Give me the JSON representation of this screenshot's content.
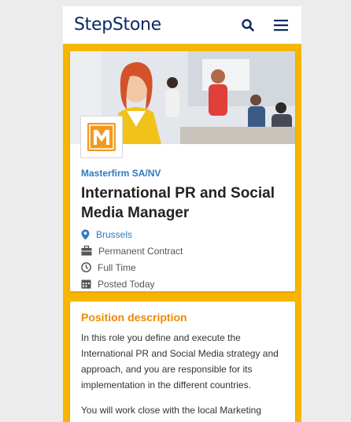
{
  "header": {
    "logo_text": "StepStone",
    "search_icon": "search-icon",
    "menu_icon": "hamburger-menu-icon"
  },
  "job": {
    "company": "Masterfirm SA/NV",
    "title": "International PR and Social Media Manager",
    "location": "Brussels",
    "contract": "Permanent Contract",
    "hours": "Full Time",
    "posted": "Posted Today",
    "company_logo_letter": "M"
  },
  "description": {
    "heading": "Position description",
    "paragraph1": "In this role you define and execute the International PR and Social Media strategy and approach, and you are responsible for its implementation in the different countries.",
    "paragraph2": "You will work close with the local Marketing Managers and Local PR responsibles.  You will"
  },
  "colors": {
    "accent_yellow": "#f7b500",
    "brand_navy": "#0b2b63",
    "link_blue": "#2f79c3",
    "section_orange": "#f08a00"
  }
}
